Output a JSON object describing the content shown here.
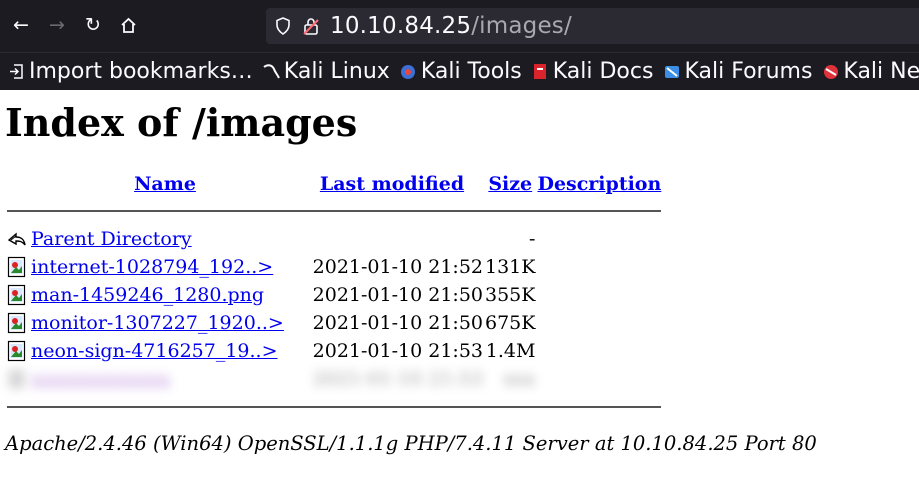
{
  "browser": {
    "url_host": "10.10.84.25",
    "url_path": "/images/",
    "bookmarks": [
      {
        "label": "Import bookmarks…",
        "icon": "import-icon"
      },
      {
        "label": "Kali Linux",
        "icon": "kali-dragon-icon"
      },
      {
        "label": "Kali Tools",
        "icon": "kali-tools-icon"
      },
      {
        "label": "Kali Docs",
        "icon": "kali-docs-icon"
      },
      {
        "label": "Kali Forums",
        "icon": "kali-forums-icon"
      },
      {
        "label": "Kali Ne",
        "icon": "kali-nethunter-icon"
      }
    ]
  },
  "page": {
    "title": "Index of /images",
    "columns": {
      "name": "Name",
      "modified": "Last modified",
      "size": "Size",
      "description": "Description"
    },
    "parent": {
      "name": "Parent Directory",
      "size": "-"
    },
    "rows": [
      {
        "name": "internet-1028794_192..>",
        "modified": "2021-01-10 21:52",
        "size": "131K"
      },
      {
        "name": "man-1459246_1280.png",
        "modified": "2021-01-10 21:50",
        "size": "355K"
      },
      {
        "name": "monitor-1307227_1920..>",
        "modified": "2021-01-10 21:50",
        "size": "675K"
      },
      {
        "name": "neon-sign-4716257_19..>",
        "modified": "2021-01-10 21:53",
        "size": "1.4M"
      }
    ],
    "blurred_row": {
      "name": "xxxxxxxxxxxxx",
      "modified": "2021-01-10 21:53",
      "size": "xxx"
    },
    "footer": "Apache/2.4.46 (Win64) OpenSSL/1.1.1g PHP/7.4.11 Server at 10.10.84.25 Port 80"
  },
  "colors": {
    "chrome_bg": "#1c1b22",
    "urlbar_bg": "#2b2a33",
    "link": "#0000ee"
  }
}
